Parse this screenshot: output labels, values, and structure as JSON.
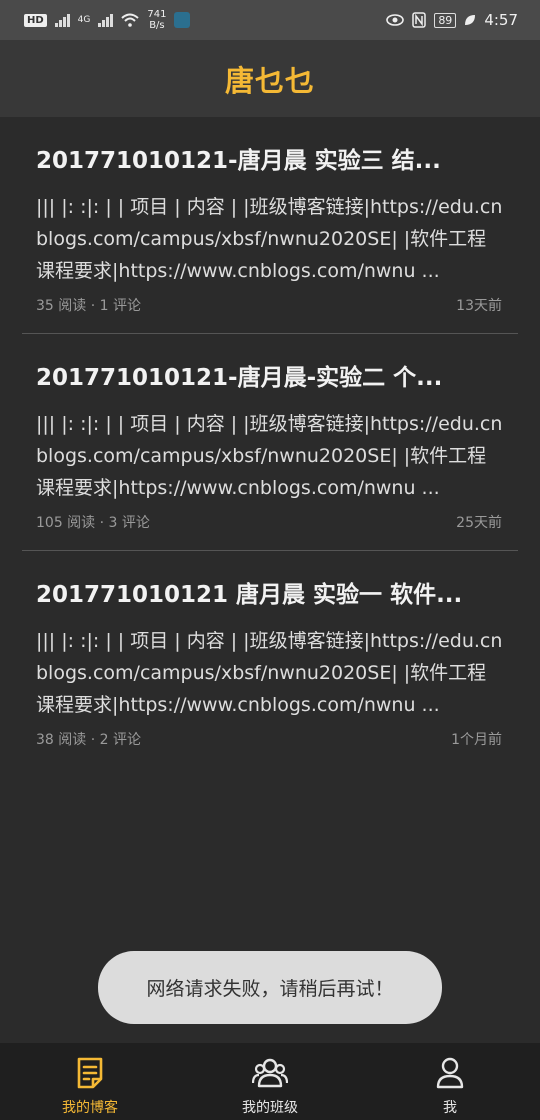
{
  "status_bar": {
    "hd_badge": "HD",
    "network": "4G",
    "speed_value": "741",
    "speed_unit": "B/s",
    "battery": "89",
    "time": "4:57"
  },
  "header": {
    "title": "唐乜乜"
  },
  "posts": [
    {
      "title": "201771010121-唐月晨 实验三 结...",
      "summary": "||| |: :|: | | 项目 | 内容 | |班级博客链接|https://edu.cnblogs.com/campus/xbsf/nwnu2020SE| |软件工程课程要求|https://www.cnblogs.com/nwnu ...",
      "stats": "35 阅读 · 1 评论",
      "time": "13天前"
    },
    {
      "title": "201771010121-唐月晨-实验二 个...",
      "summary": "||| |: :|: | | 项目 | 内容 | |班级博客链接|https://edu.cnblogs.com/campus/xbsf/nwnu2020SE| |软件工程课程要求|https://www.cnblogs.com/nwnu ...",
      "stats": "105 阅读 · 3 评论",
      "time": "25天前"
    },
    {
      "title": "201771010121 唐月晨 实验一 软件...",
      "summary": "||| |: :|: | | 项目 | 内容 | |班级博客链接|https://edu.cnblogs.com/campus/xbsf/nwnu2020SE| |软件工程课程要求|https://www.cnblogs.com/nwnu ...",
      "stats": "38 阅读 · 2 评论",
      "time": "1个月前"
    }
  ],
  "toast": {
    "message": "网络请求失败，请稍后再试！"
  },
  "bottom_nav": {
    "items": [
      {
        "label": "我的博客",
        "icon": "blog-icon",
        "active": true
      },
      {
        "label": "我的班级",
        "icon": "class-group-icon",
        "active": false
      },
      {
        "label": "我",
        "icon": "profile-icon",
        "active": false
      }
    ]
  },
  "colors": {
    "accent": "#f5b935",
    "background": "#2b2b2b",
    "header_bg": "#383838",
    "toast_bg": "#dcdcdc"
  }
}
